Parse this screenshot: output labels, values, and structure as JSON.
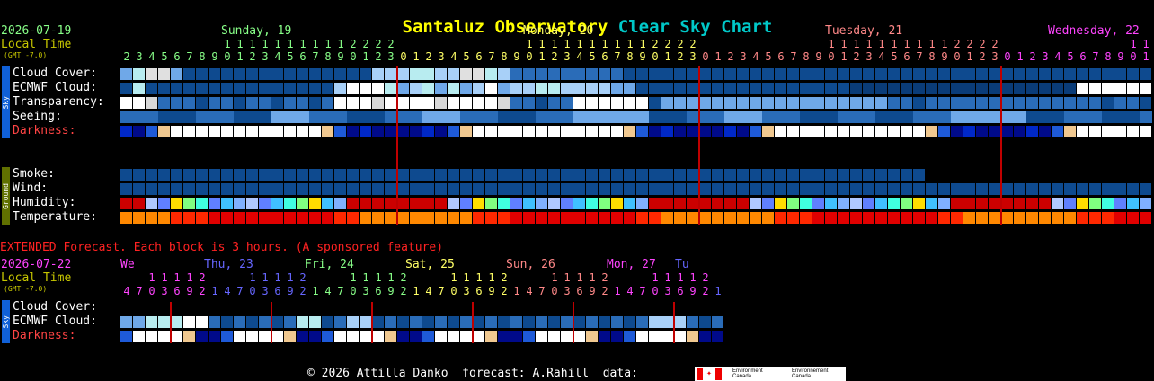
{
  "title": {
    "name": "Santaluz Observatory",
    "suffix": "Clear Sky Chart"
  },
  "header": {
    "date": "2026-07-19",
    "local_time": "Local Time",
    "gmt": "(GMT -7.0)",
    "days": [
      {
        "label": "Sunday, 19",
        "color": "#88ff88"
      },
      {
        "label": "Monday, 20",
        "color": "#ffff66"
      },
      {
        "label": "Tuesday, 21",
        "color": "#ff8888"
      },
      {
        "label": "Wednesday, 22",
        "color": "#ff44ff"
      }
    ]
  },
  "rows_sky": [
    "Cloud Cover:",
    "ECMWF Cloud:",
    "Transparency:",
    "Seeing:",
    "Darkness:"
  ],
  "rows_ground": [
    "Smoke:",
    "Wind:",
    "Humidity:",
    "Temperature:"
  ],
  "tabs": {
    "sky": "Sky",
    "ground": "Ground"
  },
  "extended": {
    "notice": "EXTENDED Forecast. Each block is 3 hours. (A sponsored feature)",
    "date": "2026-07-22",
    "local_time": "Local Time",
    "gmt": "(GMT -7.0)",
    "days": [
      {
        "label": "We",
        "color": "#ff44ff"
      },
      {
        "label": "Thu, 23",
        "color": "#6666ff"
      },
      {
        "label": "Fri, 24",
        "color": "#88ff88"
      },
      {
        "label": "Sat, 25",
        "color": "#ffff66"
      },
      {
        "label": "Sun, 26",
        "color": "#ff8888"
      },
      {
        "label": "Mon, 27",
        "color": "#ff44ff"
      },
      {
        "label": "Tu",
        "color": "#6666ff"
      }
    ],
    "rows": [
      "Cloud Cover:",
      "ECMWF Cloud:",
      "Darkness:"
    ]
  },
  "footer": {
    "text": "© 2026 Attilla Danko  forecast: A.Rahill  data:",
    "logo_text_1": "Environment Canada",
    "logo_text_2": "Environnement Canada"
  },
  "colors": {
    "title": "#ffff00",
    "title_suffix": "#00c8c8",
    "date": "#88ff88",
    "local_time": "#c8c800",
    "darkness_label": "#ff4444",
    "extended_notice": "#ff2222",
    "sky_tab": "#1060d8",
    "ground_tab": "#607000",
    "marker": "#c00000"
  }
}
